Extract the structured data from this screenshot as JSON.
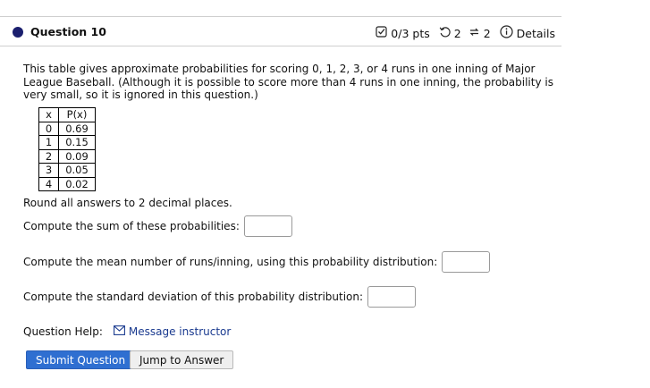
{
  "question": {
    "title": "Question 10",
    "points": "0/3 pts",
    "retries": "2",
    "submissions": "2",
    "details_label": "Details"
  },
  "prompt": "This table gives approximate probabilities for scoring 0, 1, 2, 3, or 4 runs in one inning of Major League Baseball. (Although it is possible to score more than 4 runs in one inning, the probability is very small, so it is ignored in this question.)",
  "table": {
    "headers": [
      "x",
      "P(x)"
    ],
    "rows": [
      [
        "0",
        "0.69"
      ],
      [
        "1",
        "0.15"
      ],
      [
        "2",
        "0.09"
      ],
      [
        "3",
        "0.05"
      ],
      [
        "4",
        "0.02"
      ]
    ]
  },
  "instructions": "Round all answers to 2 decimal places.",
  "parts": [
    {
      "label": "Compute the sum of these probabilities:",
      "value": ""
    },
    {
      "label": "Compute the mean number of runs/inning, using this probability distribution:",
      "value": ""
    },
    {
      "label": "Compute the standard deviation of this probability distribution:",
      "value": ""
    }
  ],
  "help": {
    "label": "Question Help:",
    "message_link": "Message instructor"
  },
  "buttons": {
    "submit": "Submit Question",
    "jump": "Jump to Answer"
  },
  "colors": {
    "accent": "#2f6fd1",
    "status_dot": "#1b1f6e",
    "link": "#1a3a8f"
  },
  "icons": [
    "status-dot-icon",
    "checkbox-icon",
    "retry-icon",
    "sync-icon",
    "info-icon",
    "mail-icon"
  ]
}
